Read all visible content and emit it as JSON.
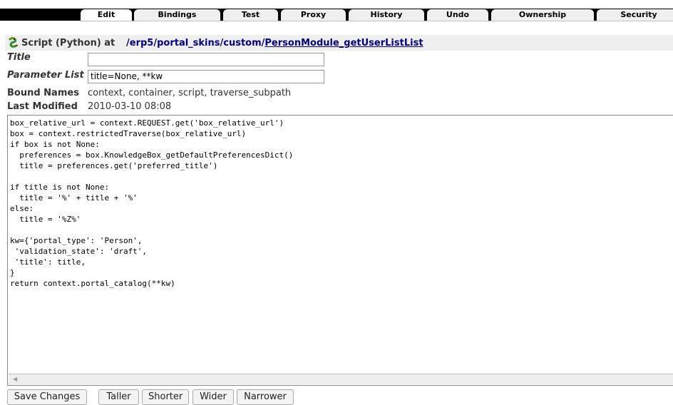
{
  "tabs": [
    {
      "label": "Edit",
      "active": true
    },
    {
      "label": "Bindings",
      "active": false
    },
    {
      "label": "Test",
      "active": false
    },
    {
      "label": "Proxy",
      "active": false
    },
    {
      "label": "History",
      "active": false
    },
    {
      "label": "Undo",
      "active": false
    },
    {
      "label": "Ownership",
      "active": false
    },
    {
      "label": "Security",
      "active": false
    }
  ],
  "header": {
    "icon": "python-script-icon",
    "type_label": "Script (Python) at",
    "path": [
      {
        "label": "/erp5",
        "current": false
      },
      {
        "label": "/",
        "sep": true
      },
      {
        "label": "portal_skins",
        "current": false
      },
      {
        "label": "/",
        "sep": true
      },
      {
        "label": "custom",
        "current": false
      },
      {
        "label": "/",
        "sep": true
      },
      {
        "label": "PersonModule_getUserListList",
        "current": true
      }
    ]
  },
  "form": {
    "title_label": "Title",
    "title_value": "",
    "params_label": "Parameter List",
    "params_value": "title=None, **kw",
    "bound_names_label": "Bound Names",
    "bound_names_value": "context, container, script, traverse_subpath",
    "last_modified_label": "Last Modified",
    "last_modified_value": "2010-03-10 08:08"
  },
  "code": "box_relative_url = context.REQUEST.get('box_relative_url')\nbox = context.restrictedTraverse(box_relative_url)\nif box is not None:\n  preferences = box.KnowledgeBox_getDefaultPreferencesDict()\n  title = preferences.get('preferred_title')\n\nif title is not None:\n  title = '%' + title + '%'\nelse:\n  title = '%Z%'\n\nkw={'portal_type': 'Person',\n 'validation_state': 'draft',\n 'title': title,\n}\nreturn context.portal_catalog(**kw)",
  "buttons": {
    "save": "Save Changes",
    "taller": "Taller",
    "shorter": "Shorter",
    "wider": "Wider",
    "narrower": "Narrower"
  },
  "colors": {
    "tabbar": "#000000",
    "header_bg": "#efefef",
    "link": "#000080"
  }
}
